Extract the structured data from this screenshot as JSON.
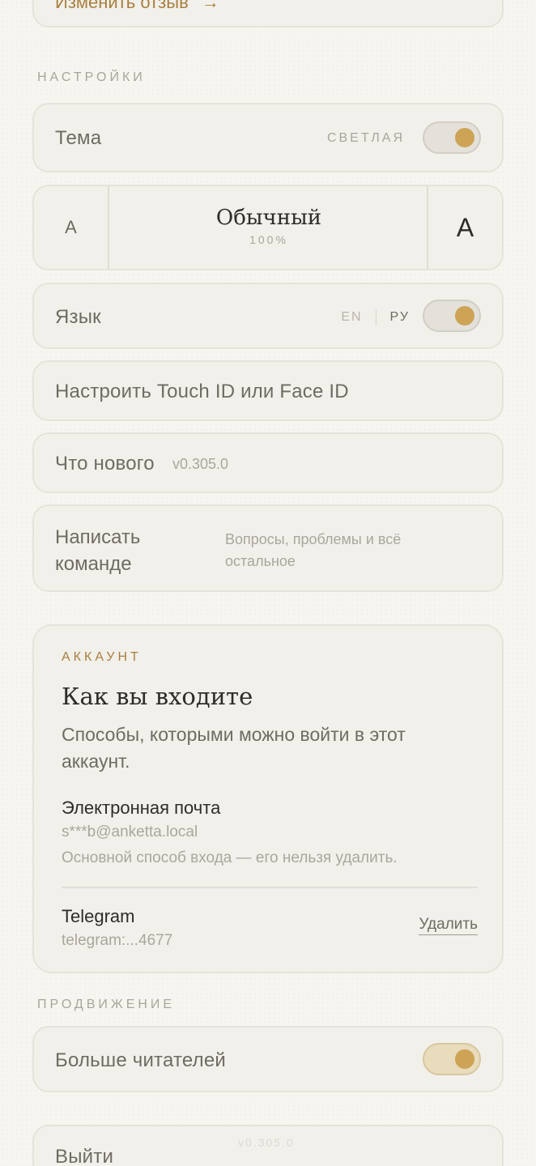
{
  "top": {
    "edit_review_label": "Изменить отзыв",
    "edit_review_arrow": "→"
  },
  "settings": {
    "section_title": "НАСТРОЙКИ",
    "theme": {
      "label": "Тема",
      "value": "СВЕТЛАЯ",
      "enabled": true
    },
    "font_size": {
      "decrease_label": "A",
      "name": "Обычный",
      "percent": "100%",
      "increase_label": "A"
    },
    "language": {
      "label": "Язык",
      "options": [
        "EN",
        "РУ"
      ],
      "selected": "РУ",
      "enabled": true
    },
    "biometrics": {
      "label": "Настроить Touch ID или Face ID"
    },
    "whats_new": {
      "label": "Что нового",
      "version": "v0.305.0"
    },
    "contact_team": {
      "label_line1": "Написать",
      "label_line2": "команде",
      "hint_line1": "Вопросы, проблемы и всё",
      "hint_line2": "остальное"
    }
  },
  "account": {
    "eyebrow": "АККАУНТ",
    "title": "Как вы входите",
    "description_line1": "Способы, которыми можно войти в этот",
    "description_line2": "аккаунт.",
    "email": {
      "label": "Электронная почта",
      "value": "s***b@anketta.local",
      "note": "Основной способ входа — его нельзя удалить."
    },
    "telegram": {
      "label": "Telegram",
      "value": "telegram:...4677",
      "remove_label": "Удалить"
    }
  },
  "promotion": {
    "section_title": "ПРОДВИЖЕНИЕ",
    "more_readers": {
      "label": "Больше читателей",
      "enabled": true
    }
  },
  "logout": {
    "label": "Выйти",
    "version": "v0.305.0"
  },
  "colors": {
    "accent": "#cda355",
    "card_bg": "#f2f0eb",
    "page_bg": "#f7f5f0",
    "eyebrow": "#a87f3e"
  }
}
